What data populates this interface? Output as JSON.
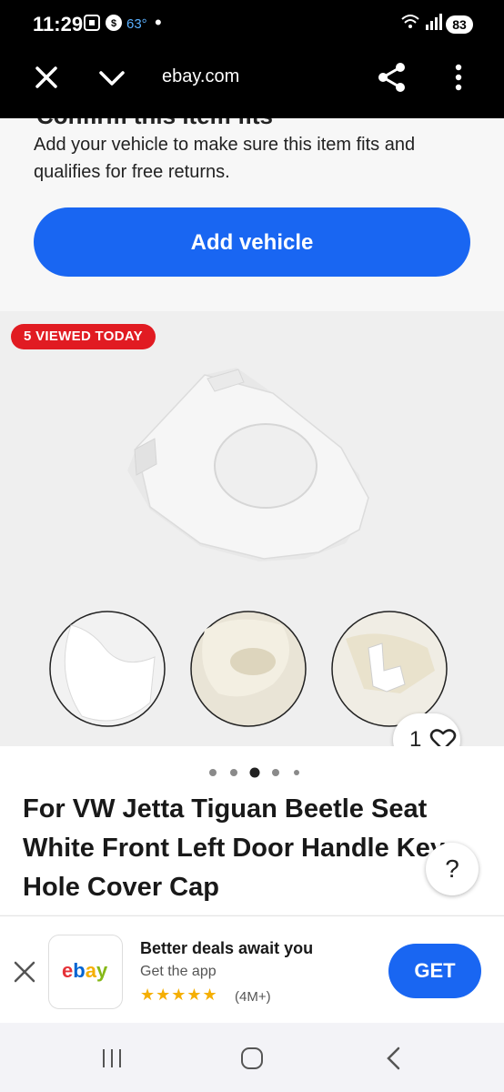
{
  "status_bar": {
    "time": "11:29",
    "temperature": "63°",
    "battery": "83",
    "icons": [
      "screenshot-icon",
      "shield-icon",
      "wifi-icon",
      "signal-icon",
      "battery-icon"
    ]
  },
  "browser": {
    "url": "ebay.com",
    "icons": [
      "close-icon",
      "chevron-down-icon",
      "share-icon",
      "kebab-menu-icon"
    ]
  },
  "confirm": {
    "title": "Confirm this item fits",
    "description": "Add your vehicle to make sure this item fits and qualifies for free returns.",
    "button_label": "Add vehicle"
  },
  "gallery": {
    "badge": "5 VIEWED TODAY",
    "watch_count": "1",
    "image_count": 5,
    "current_image": 3
  },
  "product": {
    "title": "For VW Jetta Tiguan Beetle Seat White Front Left Door Handle Key Hole Cover Cap",
    "help_label": "?"
  },
  "app_banner": {
    "logo": [
      "e",
      "b",
      "a",
      "y"
    ],
    "headline": "Better deals await you",
    "subtext": "Get the app",
    "stars": "★★★★★",
    "rating_count": "(4M+)",
    "button_label": "GET"
  },
  "colors": {
    "accent": "#1966f2",
    "badge": "#e11b22",
    "logo_e": "#e53238",
    "logo_b": "#0064d2",
    "logo_a": "#f5af02",
    "logo_y": "#86b817"
  }
}
